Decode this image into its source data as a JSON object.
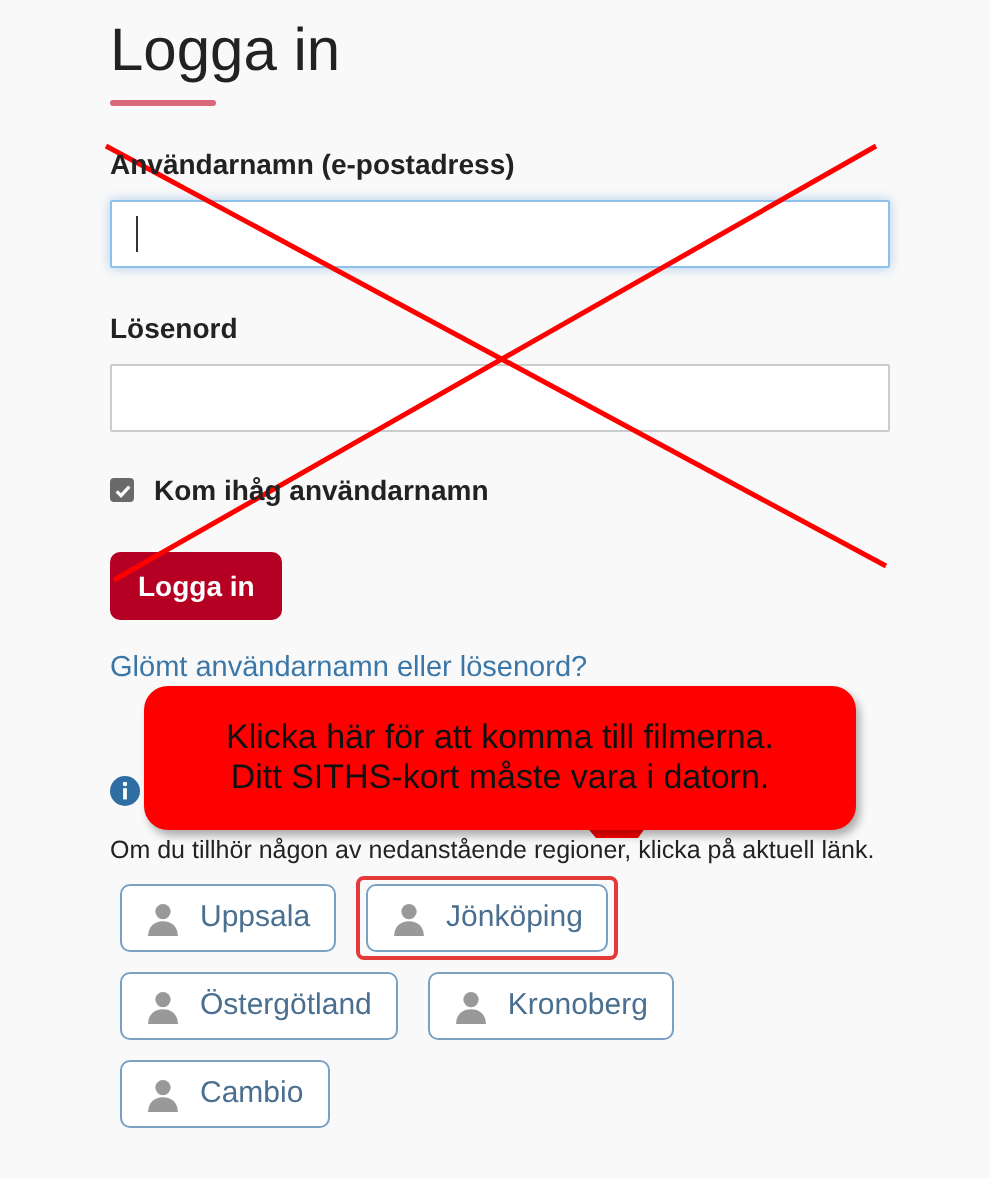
{
  "title": "Logga in",
  "fields": [
    {
      "label": "Användarnamn (e-postadress)",
      "focused": true
    },
    {
      "label": "Lösenord",
      "focused": false
    }
  ],
  "remember": {
    "label": "Kom ihåg användarnamn",
    "checked": true
  },
  "submit": "Logga in",
  "forgot_link": "Glömt användarnamn eller lösenord?",
  "instruction": "Om du tillhör någon av nedanstående regioner, klicka på aktuell länk.",
  "regions": [
    {
      "label": "Uppsala",
      "highlighted": false
    },
    {
      "label": "Jönköping",
      "highlighted": true
    },
    {
      "label": "Östergötland",
      "highlighted": false
    },
    {
      "label": "Kronoberg",
      "highlighted": false
    },
    {
      "label": "Cambio",
      "highlighted": false
    }
  ],
  "annotations": {
    "cross_out": true,
    "callout": [
      "Klicka här för att komma till filmerna.",
      "Ditt SITHS-kort måste vara i datorn."
    ]
  }
}
